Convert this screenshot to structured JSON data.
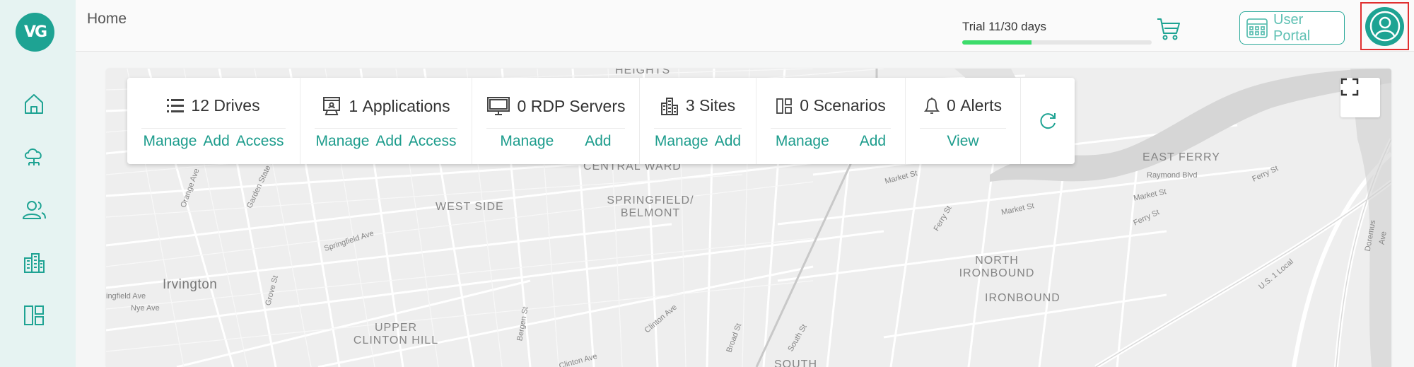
{
  "app": {
    "logo_text": "VG"
  },
  "header": {
    "title": "Home"
  },
  "trial": {
    "label": "Trial 11/30 days",
    "progress": 0.3667
  },
  "user_portal": {
    "label": "User Portal"
  },
  "sidebar": {
    "items": [
      {
        "icon": "home-icon"
      },
      {
        "icon": "cloud-network-icon"
      },
      {
        "icon": "users-icon"
      },
      {
        "icon": "buildings-icon"
      },
      {
        "icon": "dashboard-layout-icon"
      }
    ]
  },
  "stats": [
    {
      "value": "12",
      "label": "Drives",
      "icon": "list-icon",
      "actions": [
        "Manage",
        "Add",
        "Access"
      ]
    },
    {
      "value": "1",
      "label": "Applications",
      "icon": "app-window-icon",
      "actions": [
        "Manage",
        "Add",
        "Access"
      ]
    },
    {
      "value": "0",
      "label": "RDP Servers",
      "icon": "monitor-icon",
      "actions": [
        "Manage",
        "Add"
      ]
    },
    {
      "value": "3",
      "label": "Sites",
      "icon": "building-icon",
      "actions": [
        "Manage",
        "Add"
      ]
    },
    {
      "value": "0",
      "label": "Scenarios",
      "icon": "layout-icon",
      "actions": [
        "Manage",
        "Add"
      ]
    },
    {
      "value": "0",
      "label": "Alerts",
      "icon": "bell-icon",
      "actions": [
        "View"
      ]
    }
  ],
  "map": {
    "labels": {
      "heights": "HEIGHTS",
      "central_ward": "CENTRAL WARD",
      "west_side": "WEST SIDE",
      "springfield_belmont_1": "SPRINGFIELD/",
      "springfield_belmont_2": "BELMONT",
      "irvington": "Irvington",
      "upper_clinton_hill_1": "UPPER",
      "upper_clinton_hill_2": "CLINTON HILL",
      "east_ferry": "EAST FERRY",
      "north_ironbound_1": "NORTH",
      "north_ironbound_2": "IRONBOUND",
      "ironbound": "IRONBOUND",
      "south": "SOUTH"
    },
    "streets": {
      "orange_ave": "Orange Ave",
      "garden_state_pkwy": "Garden State Pkwy",
      "springfield_ave": "Springfield Ave",
      "market_st_1": "Market St",
      "market_st_2": "Market St",
      "market_st_3": "Market St",
      "raymond_blvd": "Raymond Blvd",
      "ferry_st_1": "Ferry St",
      "ferry_st_2": "Ferry St",
      "ferry_st_3": "Ferry St",
      "us_1_local": "U.S. 1 Local",
      "clinton_ave_1": "Clinton Ave",
      "clinton_ave_2": "Clinton Ave",
      "grove_st": "Grove St",
      "bergen_st": "Bergen St",
      "broad_st": "Broad St",
      "south_st": "South St",
      "field_ave": "ingfield Ave",
      "nye_ave": "Nye Ave",
      "doremus_ave": "Doremus Ave"
    }
  },
  "colors": {
    "accent": "#1ea393",
    "link": "#1c9c8c",
    "sidebar_bg": "#e6f3f2",
    "trial_fill": "#3ddc6b",
    "highlight": "#e03030"
  }
}
